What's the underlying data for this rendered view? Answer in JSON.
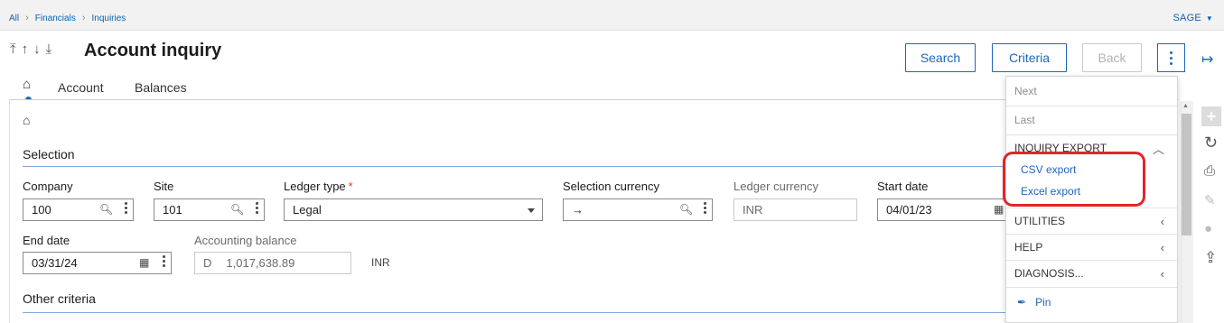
{
  "breadcrumb": [
    "All",
    "Financials",
    "Inquiries"
  ],
  "user": "SAGE",
  "page_title": "Account inquiry",
  "buttons": {
    "search": "Search",
    "criteria": "Criteria",
    "back": "Back"
  },
  "tabs": [
    "Account",
    "Balances"
  ],
  "sections": {
    "selection": "Selection",
    "other": "Other criteria"
  },
  "fields": {
    "company": {
      "label": "Company",
      "value": "100"
    },
    "site": {
      "label": "Site",
      "value": "101"
    },
    "ledger_type": {
      "label": "Ledger type",
      "required": "*",
      "value": "Legal"
    },
    "selection_currency": {
      "label": "Selection currency",
      "value": "→"
    },
    "ledger_currency": {
      "label": "Ledger currency",
      "value": "INR"
    },
    "start_date": {
      "label": "Start date",
      "value": "04/01/23"
    },
    "end_date": {
      "label": "End date",
      "value": "03/31/24"
    },
    "accounting_balance": {
      "label": "Accounting balance",
      "sign": "D",
      "value": "1,017,638.89",
      "unit": "INR"
    }
  },
  "menu": {
    "next": "Next",
    "last": "Last",
    "inquiry_export": "INQUIRY EXPORT",
    "csv_export": "CSV export",
    "excel_export": "Excel export",
    "utilities": "UTILITIES",
    "help": "HELP",
    "diagnosis": "DIAGNOSIS...",
    "pin": "Pin"
  },
  "icons": [
    "chevron-right-icon",
    "caret-down-icon",
    "first-record-icon",
    "previous-record-icon",
    "next-record-icon",
    "last-record-icon",
    "more-vertical-icon",
    "exit-icon",
    "home-icon",
    "search-icon",
    "calendar-icon",
    "chevron-up-icon",
    "chevron-left-icon",
    "pin-icon",
    "add-icon",
    "refresh-icon",
    "print-icon",
    "attachment-icon",
    "comment-icon",
    "share-icon"
  ],
  "colors": {
    "accent": "#1f66b8",
    "required": "#e0411a",
    "highlight": "#e0262b"
  }
}
